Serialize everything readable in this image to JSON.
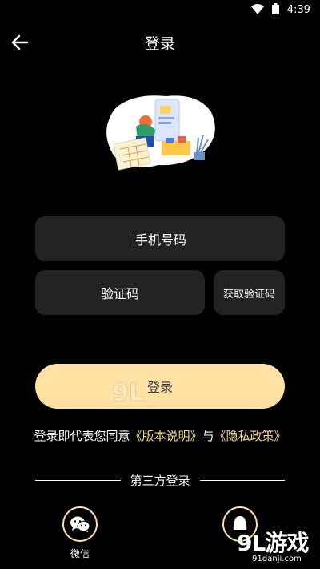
{
  "status_bar": {
    "time": "4:39"
  },
  "nav": {
    "title": "登录"
  },
  "form": {
    "phone_placeholder": "手机号码",
    "code_placeholder": "验证码",
    "get_code_label": "获取验证码",
    "login_label": "登录"
  },
  "agreement": {
    "prefix": "登录即代表您同意",
    "version_link": "《版本说明》",
    "conjunction": "与",
    "privacy_link": "《隐私政策》"
  },
  "third_party": {
    "title": "第三方登录",
    "wechat_label": "微信"
  },
  "watermark": {
    "logo": "9L游戏",
    "url": "91danji.com"
  },
  "colors": {
    "accent": "#ffe1a3",
    "link": "#ffd98a",
    "field_bg": "#232323",
    "background": "#000000"
  }
}
